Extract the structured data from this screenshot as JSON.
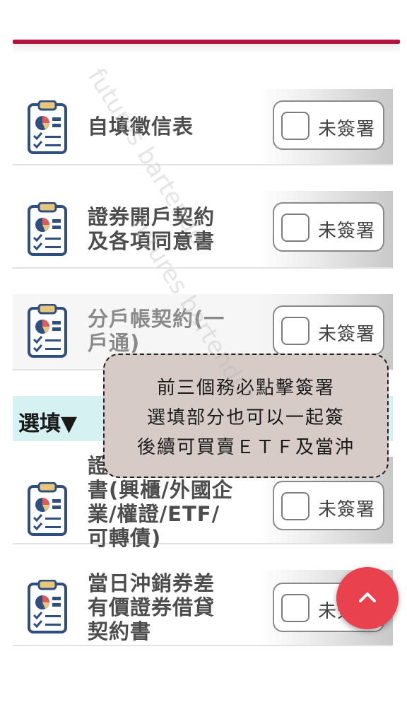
{
  "rows": [
    {
      "title": "自填徵信表",
      "status": "未簽署"
    },
    {
      "title": "證券開戶契約\n及各項同意書",
      "status": "未簽署"
    },
    {
      "title": "分戶帳契約(一\n戶通)",
      "status": "未簽署"
    },
    {
      "title": "證\n書(興櫃/外國企\n業/權證/ETF/\n可轉債)",
      "status": "未簽署"
    },
    {
      "title": "當日沖銷券差\n有價證券借貸\n契約書",
      "status": "未簽署"
    }
  ],
  "optional_section": {
    "label": "選填▼"
  },
  "tooltip": {
    "line1": "前三個務必點擊簽署",
    "line2": "選填部分也可以一起簽",
    "line3": "後續可買賣ＥＴＦ及當沖"
  },
  "watermark": {
    "text1": "futures bartender",
    "text2": "futures bartender"
  },
  "colors": {
    "accent": "#b3123f",
    "optional_bg": "#d6f1f2",
    "tooltip_bg": "#d7cbc8",
    "fab": "#e9414e"
  },
  "icons": {
    "document": "clipboard-chart-icon",
    "fab": "chevron-up-icon",
    "checkbox": "checkbox-empty-icon"
  }
}
